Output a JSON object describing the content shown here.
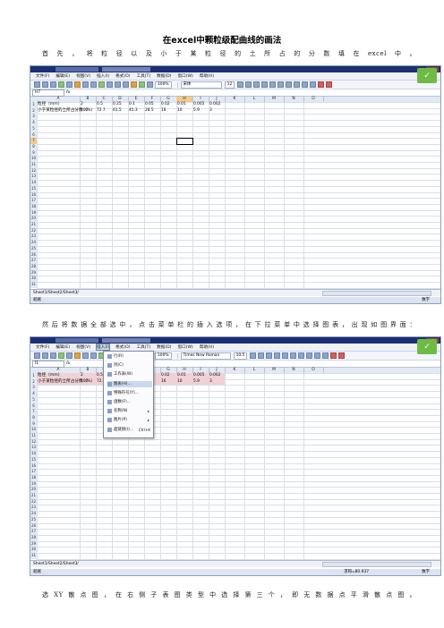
{
  "doc": {
    "title": "在excel中颗粒级配曲线的画法",
    "p1": "首先，将粒径以及小于某粒径的土所占的分数填在excel中。",
    "p2": "然后将数据全部选中，点击菜单栏的插入选项，在下拉菜单中选择图表，出现如图界面：",
    "p3": "选XY散点图，在右侧子表图类型中选择第三个，即无数据点平滑散点图。"
  },
  "app": {
    "menus": [
      "文件(F)",
      "编辑(E)",
      "视图(V)",
      "插入(I)",
      "格式(O)",
      "工具(T)",
      "数据(D)",
      "窗口(W)",
      "帮助(H)"
    ],
    "font1": "宋体",
    "font2": "Times New Roman",
    "size1": "12",
    "size2": "10.5",
    "zoom": "100%",
    "namebox1": "H7",
    "namebox2": "I1",
    "fx": "fx",
    "sheet_tabs": "Sheet1/Sheet2/Sheet3/",
    "status_left": "就绪",
    "status_right": "数字",
    "status_sum": "求和=80.937",
    "columns": [
      "A",
      "B",
      "C",
      "D",
      "E",
      "F",
      "G",
      "H",
      "I",
      "J",
      "K",
      "L",
      "M",
      "N",
      "O"
    ],
    "rows": [
      "1",
      "2",
      "3",
      "4",
      "5",
      "6",
      "7",
      "8",
      "9",
      "10",
      "11",
      "12",
      "13",
      "14",
      "15",
      "16",
      "17",
      "18",
      "19",
      "20",
      "21",
      "22",
      "23",
      "24",
      "25",
      "26",
      "27",
      "28",
      "29",
      "30",
      "31"
    ],
    "row1": [
      "粒径（mm）",
      "2",
      "0.5",
      "0.25",
      "0.1",
      "0.05",
      "0.02",
      "0.01",
      "0.005",
      "0.002"
    ],
    "row2": [
      "小于某粒径的土所占分数（%）",
      "100",
      "72.7",
      "61.5",
      "41.3",
      "28.5",
      "16",
      "10",
      "5.9",
      "3"
    ],
    "insert_menu": [
      {
        "label": "行(R)",
        "icon": "rows-icon"
      },
      {
        "label": "列(C)",
        "icon": "columns-icon"
      },
      {
        "label": "工作表(W)",
        "icon": "sheet-icon"
      },
      {
        "label": "图表(H)...",
        "icon": "chart-icon"
      },
      {
        "label": "特殊符号(Y)...",
        "icon": "symbol-icon"
      },
      {
        "label": "函数(F)...",
        "icon": "function-icon"
      },
      {
        "label": "名称(N)",
        "icon": "name-icon",
        "arrow": "▸"
      },
      {
        "label": "图片(P)",
        "icon": "picture-icon",
        "arrow": "▸"
      },
      {
        "label": "超链接(I)...",
        "icon": "link-icon",
        "shortcut": "Ctrl+K"
      }
    ]
  }
}
